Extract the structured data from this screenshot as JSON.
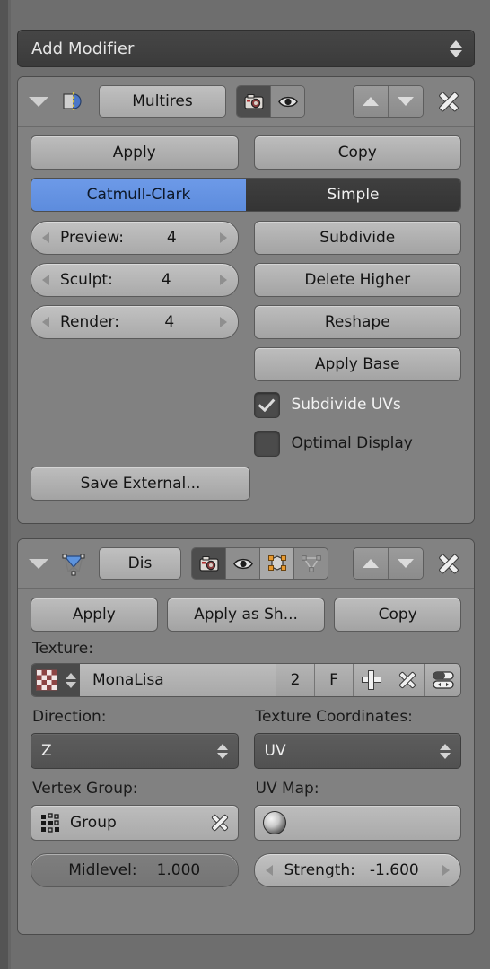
{
  "panel_type": "blender-modifier-properties",
  "add_modifier": {
    "label": "Add Modifier",
    "icon": "updown-arrows-icon"
  },
  "modifiers": [
    {
      "name": "Multires",
      "type_icon": "subsurf-modifier-icon",
      "collapse_icon": "triangle-down-icon",
      "header_toggles": [
        {
          "name": "render-toggle",
          "icon": "camera-icon",
          "active": true
        },
        {
          "name": "realtime-toggle",
          "icon": "eye-icon",
          "active": false
        }
      ],
      "move_up_label": "move-up",
      "move_down_label": "move-down",
      "close_label": "X",
      "buttons": {
        "apply": "Apply",
        "copy": "Copy"
      },
      "subdivision_type": {
        "options": [
          "Catmull-Clark",
          "Simple"
        ],
        "selected": "Catmull-Clark"
      },
      "levels": [
        {
          "label": "Preview:",
          "value": "4"
        },
        {
          "label": "Sculpt:",
          "value": "4"
        },
        {
          "label": "Render:",
          "value": "4"
        }
      ],
      "ops": [
        "Subdivide",
        "Delete Higher",
        "Reshape",
        "Apply Base"
      ],
      "checkboxes": [
        {
          "label": "Subdivide UVs",
          "checked": true
        },
        {
          "label": "Optimal Display",
          "checked": false
        }
      ],
      "save_external": "Save External..."
    },
    {
      "name": "Dis",
      "type_icon": "displace-modifier-icon",
      "collapse_icon": "triangle-down-icon",
      "header_toggles": [
        {
          "name": "render-toggle",
          "icon": "camera-icon",
          "active": true
        },
        {
          "name": "realtime-toggle",
          "icon": "eye-icon",
          "active": false
        },
        {
          "name": "editmode-toggle",
          "icon": "editmode-cube-icon",
          "active": true
        },
        {
          "name": "oncage-toggle",
          "icon": "oncage-triangle-icon",
          "active": false
        }
      ],
      "buttons": {
        "apply": "Apply",
        "apply_as_shape": "Apply as Sh...",
        "copy": "Copy"
      },
      "texture": {
        "label": "Texture:",
        "datablock_icon": "checker-texture-icon",
        "value": "MonaLisa",
        "users": "2",
        "fake_user": "F",
        "new_label": "+",
        "unlink_label": "X",
        "browse_icon": "texture-properties-icon"
      },
      "direction": {
        "label": "Direction:",
        "value": "Z"
      },
      "texture_coordinates": {
        "label": "Texture Coordinates:",
        "value": "UV"
      },
      "vertex_group": {
        "label": "Vertex Group:",
        "value": "Group",
        "icon": "vertexgroup-icon",
        "clear_icon": "x-icon"
      },
      "uv_map": {
        "label": "UV Map:",
        "value": "",
        "icon": "uv-sphere-icon"
      },
      "midlevel": {
        "label": "Midlevel:",
        "value": "1.000"
      },
      "strength": {
        "label": "Strength:",
        "value": "-1.600"
      }
    }
  ],
  "colors": {
    "panel_bg": "#818181",
    "window_bg": "#6e6e6e",
    "accent_selected": "#5d8cdd",
    "button_face": "#b0b0b0",
    "dropdown_dark": "#3b3b3b"
  }
}
